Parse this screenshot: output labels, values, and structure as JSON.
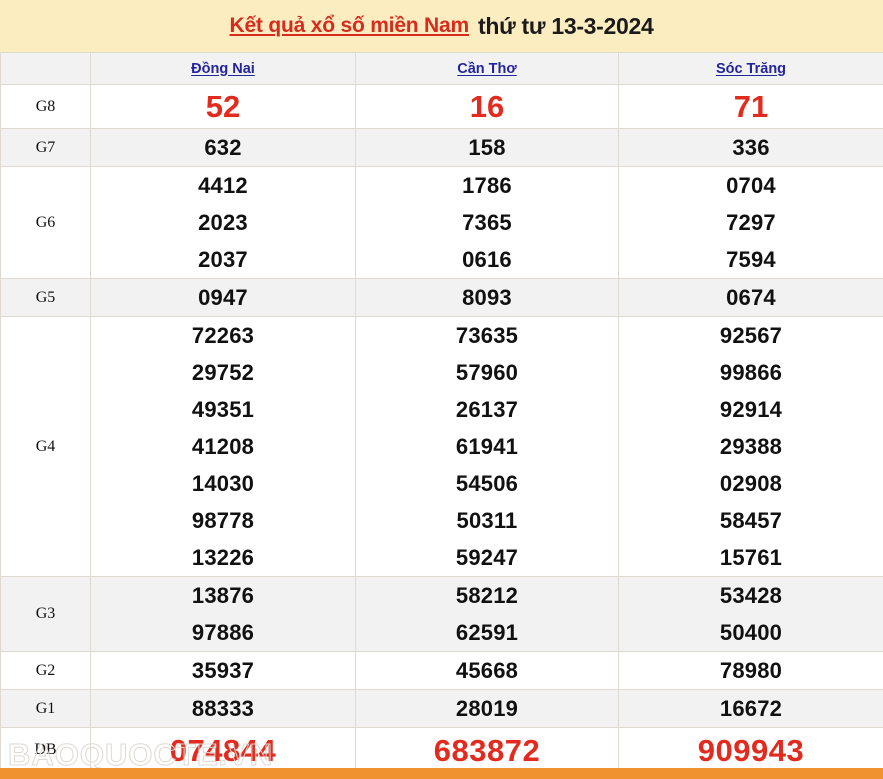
{
  "banner": {
    "link_text": "Kết quả xổ số miền Nam",
    "date_text": "thứ tư 13-3-2024",
    "link_color": "#d82b1e",
    "background": "#fbedc0"
  },
  "table": {
    "corner_label": "",
    "columns": [
      {
        "name": "Đồng Nai",
        "color": "#24249c"
      },
      {
        "name": "Cần Thơ",
        "color": "#24249c"
      },
      {
        "name": "Sóc Trăng",
        "color": "#24249c"
      }
    ],
    "rows": [
      {
        "prize": "G8",
        "style": "red-small",
        "values": [
          [
            "52"
          ],
          [
            "16"
          ],
          [
            "71"
          ]
        ]
      },
      {
        "prize": "G7",
        "style": "normal",
        "values": [
          [
            "632"
          ],
          [
            "158"
          ],
          [
            "336"
          ]
        ]
      },
      {
        "prize": "G6",
        "style": "normal",
        "values": [
          [
            "4412",
            "2023",
            "2037"
          ],
          [
            "1786",
            "7365",
            "0616"
          ],
          [
            "0704",
            "7297",
            "7594"
          ]
        ]
      },
      {
        "prize": "G5",
        "style": "normal",
        "values": [
          [
            "0947"
          ],
          [
            "8093"
          ],
          [
            "0674"
          ]
        ]
      },
      {
        "prize": "G4",
        "style": "normal",
        "values": [
          [
            "72263",
            "29752",
            "49351",
            "41208",
            "14030",
            "98778",
            "13226"
          ],
          [
            "73635",
            "57960",
            "26137",
            "61941",
            "54506",
            "50311",
            "59247"
          ],
          [
            "92567",
            "99866",
            "92914",
            "29388",
            "02908",
            "58457",
            "15761"
          ]
        ]
      },
      {
        "prize": "G3",
        "style": "normal",
        "values": [
          [
            "13876",
            "97886"
          ],
          [
            "58212",
            "62591"
          ],
          [
            "53428",
            "50400"
          ]
        ]
      },
      {
        "prize": "G2",
        "style": "normal",
        "values": [
          [
            "35937"
          ],
          [
            "45668"
          ],
          [
            "78980"
          ]
        ]
      },
      {
        "prize": "G1",
        "style": "normal",
        "values": [
          [
            "88333"
          ],
          [
            "28019"
          ],
          [
            "16672"
          ]
        ]
      },
      {
        "prize": "DB",
        "style": "red-large",
        "values": [
          [
            "074844"
          ],
          [
            "683872"
          ],
          [
            "909943"
          ]
        ]
      }
    ]
  },
  "watermark": {
    "text": "BAOQUOCTE.VN"
  },
  "bottom_bar": {
    "color": "#f0922f"
  }
}
